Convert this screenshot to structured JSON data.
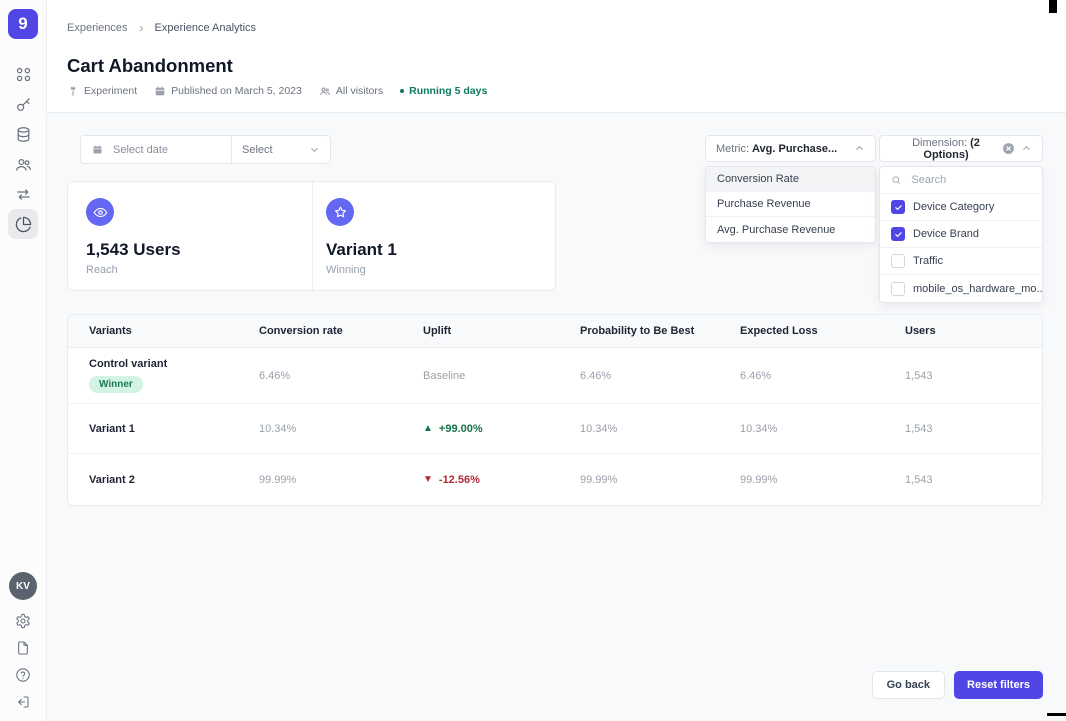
{
  "app": {
    "logo_glyph": "9"
  },
  "colors": {
    "accent": "#4f46e5",
    "icon_circle": "#6467f2",
    "running_status": "#0e7a5f",
    "positive": "#157347",
    "negative": "#b02a37",
    "winner_badge_bg": "#d3f3e3",
    "winner_badge_text": "#1d7a55"
  },
  "sidebar": {
    "avatar_initials": "KV",
    "nav_icons": [
      "grid",
      "key",
      "database",
      "users",
      "transfer",
      "pie-chart"
    ],
    "bottom_icons": [
      "gear",
      "document",
      "help",
      "logout"
    ]
  },
  "breadcrumb": {
    "items": [
      "Experiences",
      "Experience Analytics"
    ]
  },
  "page": {
    "title": "Cart Abandonment",
    "meta": {
      "type": "Experiment",
      "published": "Published on March 5, 2023",
      "audience": "All visitors",
      "status": "Running 5 days"
    }
  },
  "filters": {
    "date_placeholder": "Select date",
    "select_label": "Select",
    "metric": {
      "prefix": "Metric:",
      "value": "Avg. Purchase...",
      "options": [
        "Conversion Rate",
        "Purchase Revenue",
        "Avg. Purchase Revenue"
      ]
    },
    "dimension": {
      "prefix": "Dimension:",
      "value": "(2 Options)",
      "search_placeholder": "Search",
      "options": [
        {
          "label": "Device Category",
          "checked": true
        },
        {
          "label": "Device Brand",
          "checked": true
        },
        {
          "label": "Traffic",
          "checked": false
        },
        {
          "label": "mobile_os_hardware_mo...",
          "checked": false
        }
      ]
    }
  },
  "summary": {
    "reach": {
      "title": "1,543 Users",
      "subtitle": "Reach"
    },
    "winner": {
      "title": "Variant 1",
      "subtitle": "Winning"
    }
  },
  "table": {
    "columns": [
      "Variants",
      "Conversion rate",
      "Uplift",
      "Probability to Be Best",
      "Expected Loss",
      "Users"
    ],
    "icons": {
      "up": "▲",
      "down": "▼"
    },
    "rows": [
      {
        "name": "Control variant",
        "badge": "Winner",
        "conversion_rate": "6.46%",
        "uplift": "Baseline",
        "direction": "none",
        "probability": "6.46%",
        "expected_loss": "6.46%",
        "users": "1,543"
      },
      {
        "name": "Variant 1",
        "conversion_rate": "10.34%",
        "uplift": "+99.00%",
        "direction": "up",
        "probability": "10.34%",
        "expected_loss": "10.34%",
        "users": "1,543"
      },
      {
        "name": "Variant 2",
        "conversion_rate": "99.99%",
        "uplift": "-12.56%",
        "direction": "down",
        "probability": "99.99%",
        "expected_loss": "99.99%",
        "users": "1,543"
      }
    ]
  },
  "actions": {
    "go_back": "Go back",
    "reset_filters": "Reset filters"
  }
}
